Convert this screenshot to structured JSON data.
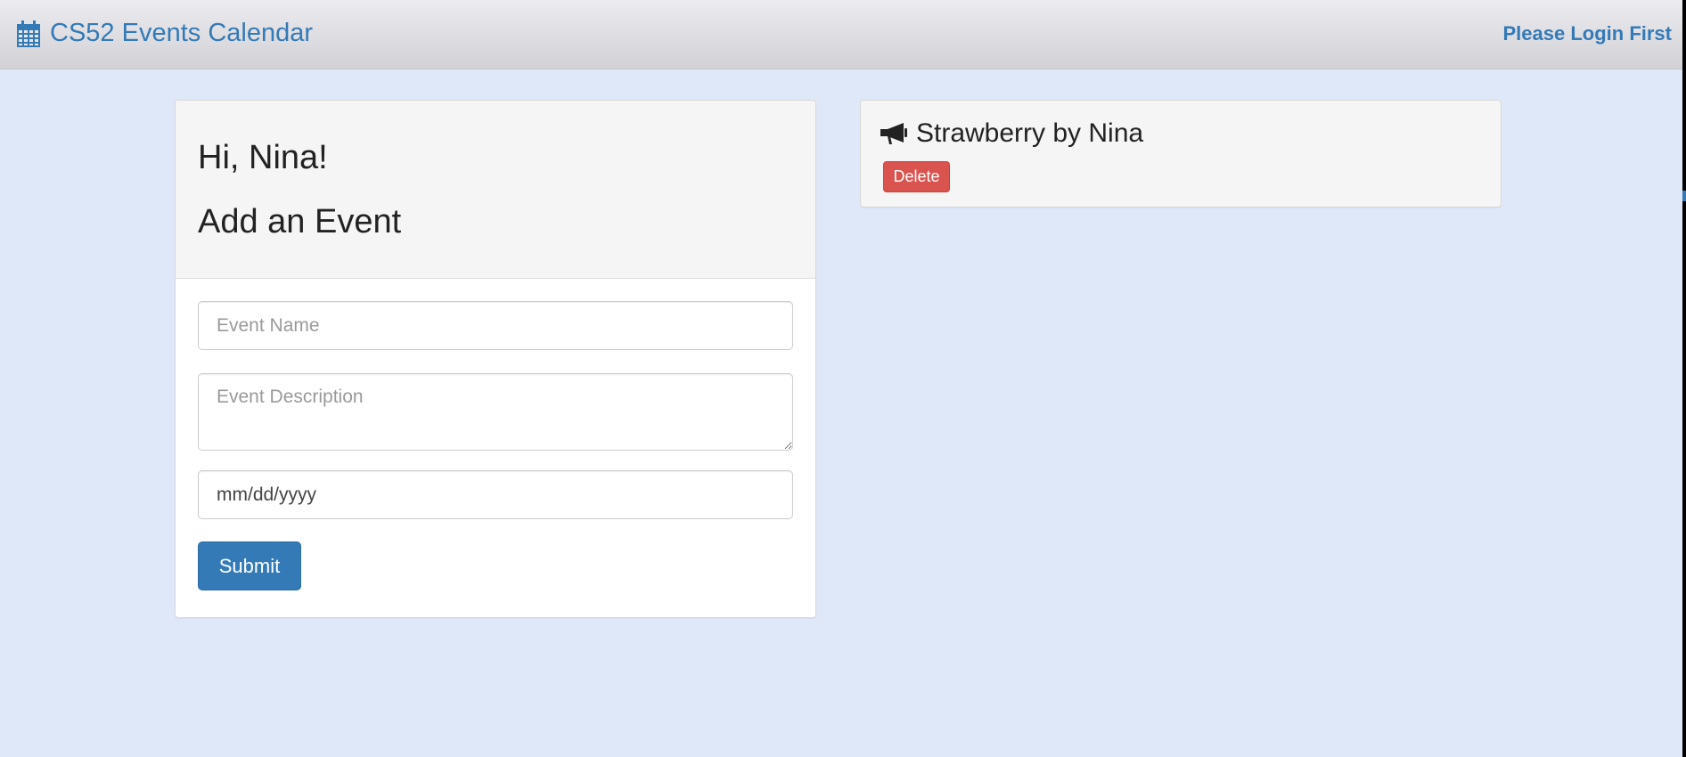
{
  "navbar": {
    "brand_label": "CS52 Events Calendar",
    "brand_icon": "calendar-icon",
    "login_label": "Please Login First",
    "link_color": "#337ab7"
  },
  "form_panel": {
    "greeting": "Hi, Nina!",
    "heading": "Add an Event",
    "event_name_placeholder": "Event Name",
    "event_description_placeholder": "Event Description",
    "date_value": "mm/dd/yyyy",
    "submit_label": "Submit",
    "submit_color": "#337ab7"
  },
  "events": [
    {
      "icon": "bullhorn-icon",
      "title": "Strawberry by Nina",
      "delete_label": "Delete",
      "delete_color": "#d9534f"
    }
  ],
  "colors": {
    "page_background": "#dfe8f8",
    "panel_heading_background": "#f5f5f5"
  }
}
